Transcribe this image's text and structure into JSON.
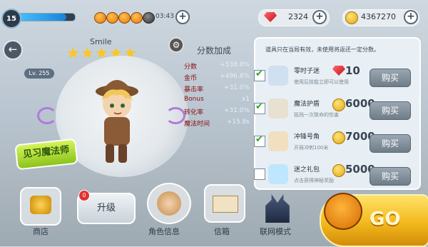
{
  "top_bar": {
    "level": "15",
    "xp_progress": 0.85,
    "timer": "03:43",
    "gems": "2324",
    "coins": "4367270"
  },
  "player": {
    "name": "Smile",
    "level_badge": "Lv. 255",
    "stars": 5,
    "title_badge": "见习魔法师"
  },
  "score_bonus": {
    "title": "分数加成",
    "rows": [
      {
        "label": "分数",
        "value": "+538.8%"
      },
      {
        "label": "金币",
        "value": "+496.8%"
      },
      {
        "label": "暴击率",
        "value": "+31.0%"
      },
      {
        "label": "Bonus",
        "value": "x1"
      },
      {
        "label": "转化率",
        "value": "+31.0%"
      },
      {
        "label": "魔法时间",
        "value": "+15.8s"
      }
    ]
  },
  "shop": {
    "note": "道具只在当局有效，未使用将返还一定分数。",
    "items": [
      {
        "name": "零时子迷",
        "desc": "使用后技能立即可以使用",
        "price": "10",
        "currency": "gem",
        "checked": true,
        "buy": "购买"
      },
      {
        "name": "魔法护盾",
        "desc": "抵挡一次致命的伤害",
        "price": "6000",
        "currency": "coin",
        "checked": true,
        "buy": "购买"
      },
      {
        "name": "冲锋号角",
        "desc": "开局冲刺100米",
        "price": "7000",
        "currency": "coin",
        "checked": true,
        "buy": "购买"
      },
      {
        "name": "迷之礼包",
        "desc": "点击获得神秘奖励",
        "price": "5000",
        "currency": "coin",
        "checked": false,
        "buy": "购买"
      }
    ]
  },
  "bottom_nav": {
    "shop": "商店",
    "upgrade": "升级",
    "upgrade_badge": "0",
    "character": "角色信息",
    "mail": "信箱",
    "network": "联网模式",
    "go": "GO"
  }
}
